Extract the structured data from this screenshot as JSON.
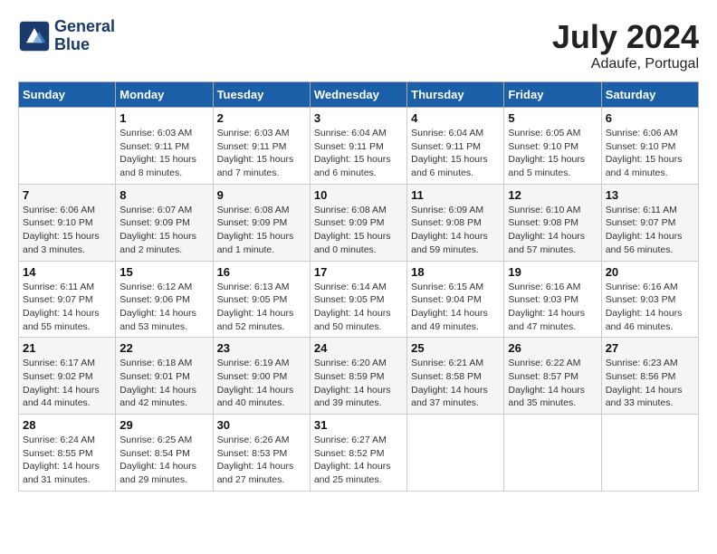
{
  "header": {
    "logo_line1": "General",
    "logo_line2": "Blue",
    "month_year": "July 2024",
    "location": "Adaufe, Portugal"
  },
  "weekdays": [
    "Sunday",
    "Monday",
    "Tuesday",
    "Wednesday",
    "Thursday",
    "Friday",
    "Saturday"
  ],
  "weeks": [
    [
      {
        "day": "",
        "sunrise": "",
        "sunset": "",
        "daylight": ""
      },
      {
        "day": "1",
        "sunrise": "Sunrise: 6:03 AM",
        "sunset": "Sunset: 9:11 PM",
        "daylight": "Daylight: 15 hours and 8 minutes."
      },
      {
        "day": "2",
        "sunrise": "Sunrise: 6:03 AM",
        "sunset": "Sunset: 9:11 PM",
        "daylight": "Daylight: 15 hours and 7 minutes."
      },
      {
        "day": "3",
        "sunrise": "Sunrise: 6:04 AM",
        "sunset": "Sunset: 9:11 PM",
        "daylight": "Daylight: 15 hours and 6 minutes."
      },
      {
        "day": "4",
        "sunrise": "Sunrise: 6:04 AM",
        "sunset": "Sunset: 9:11 PM",
        "daylight": "Daylight: 15 hours and 6 minutes."
      },
      {
        "day": "5",
        "sunrise": "Sunrise: 6:05 AM",
        "sunset": "Sunset: 9:10 PM",
        "daylight": "Daylight: 15 hours and 5 minutes."
      },
      {
        "day": "6",
        "sunrise": "Sunrise: 6:06 AM",
        "sunset": "Sunset: 9:10 PM",
        "daylight": "Daylight: 15 hours and 4 minutes."
      }
    ],
    [
      {
        "day": "7",
        "sunrise": "Sunrise: 6:06 AM",
        "sunset": "Sunset: 9:10 PM",
        "daylight": "Daylight: 15 hours and 3 minutes."
      },
      {
        "day": "8",
        "sunrise": "Sunrise: 6:07 AM",
        "sunset": "Sunset: 9:09 PM",
        "daylight": "Daylight: 15 hours and 2 minutes."
      },
      {
        "day": "9",
        "sunrise": "Sunrise: 6:08 AM",
        "sunset": "Sunset: 9:09 PM",
        "daylight": "Daylight: 15 hours and 1 minute."
      },
      {
        "day": "10",
        "sunrise": "Sunrise: 6:08 AM",
        "sunset": "Sunset: 9:09 PM",
        "daylight": "Daylight: 15 hours and 0 minutes."
      },
      {
        "day": "11",
        "sunrise": "Sunrise: 6:09 AM",
        "sunset": "Sunset: 9:08 PM",
        "daylight": "Daylight: 14 hours and 59 minutes."
      },
      {
        "day": "12",
        "sunrise": "Sunrise: 6:10 AM",
        "sunset": "Sunset: 9:08 PM",
        "daylight": "Daylight: 14 hours and 57 minutes."
      },
      {
        "day": "13",
        "sunrise": "Sunrise: 6:11 AM",
        "sunset": "Sunset: 9:07 PM",
        "daylight": "Daylight: 14 hours and 56 minutes."
      }
    ],
    [
      {
        "day": "14",
        "sunrise": "Sunrise: 6:11 AM",
        "sunset": "Sunset: 9:07 PM",
        "daylight": "Daylight: 14 hours and 55 minutes."
      },
      {
        "day": "15",
        "sunrise": "Sunrise: 6:12 AM",
        "sunset": "Sunset: 9:06 PM",
        "daylight": "Daylight: 14 hours and 53 minutes."
      },
      {
        "day": "16",
        "sunrise": "Sunrise: 6:13 AM",
        "sunset": "Sunset: 9:05 PM",
        "daylight": "Daylight: 14 hours and 52 minutes."
      },
      {
        "day": "17",
        "sunrise": "Sunrise: 6:14 AM",
        "sunset": "Sunset: 9:05 PM",
        "daylight": "Daylight: 14 hours and 50 minutes."
      },
      {
        "day": "18",
        "sunrise": "Sunrise: 6:15 AM",
        "sunset": "Sunset: 9:04 PM",
        "daylight": "Daylight: 14 hours and 49 minutes."
      },
      {
        "day": "19",
        "sunrise": "Sunrise: 6:16 AM",
        "sunset": "Sunset: 9:03 PM",
        "daylight": "Daylight: 14 hours and 47 minutes."
      },
      {
        "day": "20",
        "sunrise": "Sunrise: 6:16 AM",
        "sunset": "Sunset: 9:03 PM",
        "daylight": "Daylight: 14 hours and 46 minutes."
      }
    ],
    [
      {
        "day": "21",
        "sunrise": "Sunrise: 6:17 AM",
        "sunset": "Sunset: 9:02 PM",
        "daylight": "Daylight: 14 hours and 44 minutes."
      },
      {
        "day": "22",
        "sunrise": "Sunrise: 6:18 AM",
        "sunset": "Sunset: 9:01 PM",
        "daylight": "Daylight: 14 hours and 42 minutes."
      },
      {
        "day": "23",
        "sunrise": "Sunrise: 6:19 AM",
        "sunset": "Sunset: 9:00 PM",
        "daylight": "Daylight: 14 hours and 40 minutes."
      },
      {
        "day": "24",
        "sunrise": "Sunrise: 6:20 AM",
        "sunset": "Sunset: 8:59 PM",
        "daylight": "Daylight: 14 hours and 39 minutes."
      },
      {
        "day": "25",
        "sunrise": "Sunrise: 6:21 AM",
        "sunset": "Sunset: 8:58 PM",
        "daylight": "Daylight: 14 hours and 37 minutes."
      },
      {
        "day": "26",
        "sunrise": "Sunrise: 6:22 AM",
        "sunset": "Sunset: 8:57 PM",
        "daylight": "Daylight: 14 hours and 35 minutes."
      },
      {
        "day": "27",
        "sunrise": "Sunrise: 6:23 AM",
        "sunset": "Sunset: 8:56 PM",
        "daylight": "Daylight: 14 hours and 33 minutes."
      }
    ],
    [
      {
        "day": "28",
        "sunrise": "Sunrise: 6:24 AM",
        "sunset": "Sunset: 8:55 PM",
        "daylight": "Daylight: 14 hours and 31 minutes."
      },
      {
        "day": "29",
        "sunrise": "Sunrise: 6:25 AM",
        "sunset": "Sunset: 8:54 PM",
        "daylight": "Daylight: 14 hours and 29 minutes."
      },
      {
        "day": "30",
        "sunrise": "Sunrise: 6:26 AM",
        "sunset": "Sunset: 8:53 PM",
        "daylight": "Daylight: 14 hours and 27 minutes."
      },
      {
        "day": "31",
        "sunrise": "Sunrise: 6:27 AM",
        "sunset": "Sunset: 8:52 PM",
        "daylight": "Daylight: 14 hours and 25 minutes."
      },
      {
        "day": "",
        "sunrise": "",
        "sunset": "",
        "daylight": ""
      },
      {
        "day": "",
        "sunrise": "",
        "sunset": "",
        "daylight": ""
      },
      {
        "day": "",
        "sunrise": "",
        "sunset": "",
        "daylight": ""
      }
    ]
  ]
}
